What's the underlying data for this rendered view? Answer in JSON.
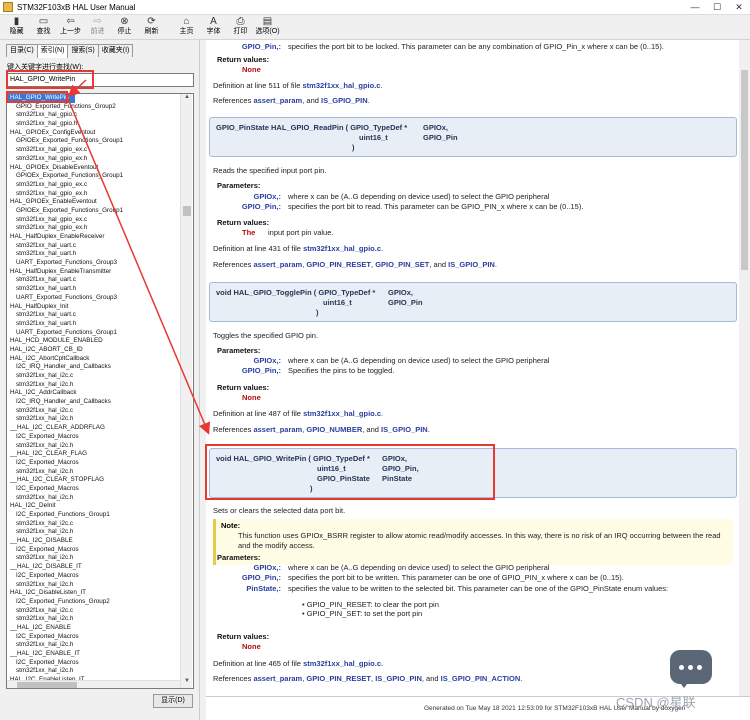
{
  "window": {
    "title": "STM32F103xB HAL User Manual"
  },
  "toolbar": [
    {
      "label": "隐藏",
      "icon": "▮"
    },
    {
      "label": "查找",
      "icon": "▭"
    },
    {
      "label": "上一步",
      "icon": "⇦"
    },
    {
      "label": "前进",
      "icon": "⇨",
      "disabled": true
    },
    {
      "label": "停止",
      "icon": "⊗"
    },
    {
      "label": "刷新",
      "icon": "⟳"
    },
    {
      "label": "主页",
      "icon": "⌂"
    },
    {
      "label": "字体",
      "icon": "A"
    },
    {
      "label": "打印",
      "icon": "⎙"
    },
    {
      "label": "选项(O)",
      "icon": "▤"
    }
  ],
  "left": {
    "tabs": [
      "目录(C)",
      "索引(N)",
      "搜索(S)",
      "收藏夹(I)"
    ],
    "keyword_label": "键入关键字进行查找(W):",
    "search_value": "HAL_GPIO_WritePin",
    "show_button": "显示(D)",
    "items": [
      {
        "t": "HAL_GPIO_WritePin",
        "lv": 1,
        "sel": true
      },
      {
        "t": "GPIO_Exported_Functions_Group2",
        "lv": 2
      },
      {
        "t": "stm32f1xx_hal_gpio.c",
        "lv": 2
      },
      {
        "t": "stm32f1xx_hal_gpio.h",
        "lv": 2
      },
      {
        "t": "HAL_GPIOEx_ConfigEventout",
        "lv": 1
      },
      {
        "t": "GPIOEx_Exported_Functions_Group1",
        "lv": 2
      },
      {
        "t": "stm32f1xx_hal_gpio_ex.c",
        "lv": 2
      },
      {
        "t": "stm32f1xx_hal_gpio_ex.h",
        "lv": 2
      },
      {
        "t": "HAL_GPIOEx_DisableEventout",
        "lv": 1
      },
      {
        "t": "GPIOEx_Exported_Functions_Group1",
        "lv": 2
      },
      {
        "t": "stm32f1xx_hal_gpio_ex.c",
        "lv": 2
      },
      {
        "t": "stm32f1xx_hal_gpio_ex.h",
        "lv": 2
      },
      {
        "t": "HAL_GPIOEx_EnableEventout",
        "lv": 1
      },
      {
        "t": "GPIOEx_Exported_Functions_Group1",
        "lv": 2
      },
      {
        "t": "stm32f1xx_hal_gpio_ex.c",
        "lv": 2
      },
      {
        "t": "stm32f1xx_hal_gpio_ex.h",
        "lv": 2
      },
      {
        "t": "HAL_HalfDuplex_EnableReceiver",
        "lv": 1
      },
      {
        "t": "stm32f1xx_hal_uart.c",
        "lv": 2
      },
      {
        "t": "stm32f1xx_hal_uart.h",
        "lv": 2
      },
      {
        "t": "UART_Exported_Functions_Group3",
        "lv": 2
      },
      {
        "t": "HAL_HalfDuplex_EnableTransmitter",
        "lv": 1
      },
      {
        "t": "stm32f1xx_hal_uart.c",
        "lv": 2
      },
      {
        "t": "stm32f1xx_hal_uart.h",
        "lv": 2
      },
      {
        "t": "UART_Exported_Functions_Group3",
        "lv": 2
      },
      {
        "t": "HAL_HalfDuplex_Init",
        "lv": 1
      },
      {
        "t": "stm32f1xx_hal_uart.c",
        "lv": 2
      },
      {
        "t": "stm32f1xx_hal_uart.h",
        "lv": 2
      },
      {
        "t": "UART_Exported_Functions_Group1",
        "lv": 2
      },
      {
        "t": "HAL_HCD_MODULE_ENABLED",
        "lv": 1
      },
      {
        "t": "HAL_I2C_ABORT_CB_ID",
        "lv": 1
      },
      {
        "t": "HAL_I2C_AbortCpltCallback",
        "lv": 1
      },
      {
        "t": "I2C_IRQ_Handler_and_Callbacks",
        "lv": 2
      },
      {
        "t": "stm32f1xx_hal_i2c.c",
        "lv": 2
      },
      {
        "t": "stm32f1xx_hal_i2c.h",
        "lv": 2
      },
      {
        "t": "HAL_I2C_AddrCallback",
        "lv": 1
      },
      {
        "t": "I2C_IRQ_Handler_and_Callbacks",
        "lv": 2
      },
      {
        "t": "stm32f1xx_hal_i2c.c",
        "lv": 2
      },
      {
        "t": "stm32f1xx_hal_i2c.h",
        "lv": 2
      },
      {
        "t": "__HAL_I2C_CLEAR_ADDRFLAG",
        "lv": 1
      },
      {
        "t": "I2C_Exported_Macros",
        "lv": 2
      },
      {
        "t": "stm32f1xx_hal_i2c.h",
        "lv": 2
      },
      {
        "t": "__HAL_I2C_CLEAR_FLAG",
        "lv": 1
      },
      {
        "t": "I2C_Exported_Macros",
        "lv": 2
      },
      {
        "t": "stm32f1xx_hal_i2c.h",
        "lv": 2
      },
      {
        "t": "__HAL_I2C_CLEAR_STOPFLAG",
        "lv": 1
      },
      {
        "t": "I2C_Exported_Macros",
        "lv": 2
      },
      {
        "t": "stm32f1xx_hal_i2c.h",
        "lv": 2
      },
      {
        "t": "HAL_I2C_DeInit",
        "lv": 1
      },
      {
        "t": "I2C_Exported_Functions_Group1",
        "lv": 2
      },
      {
        "t": "stm32f1xx_hal_i2c.c",
        "lv": 2
      },
      {
        "t": "stm32f1xx_hal_i2c.h",
        "lv": 2
      },
      {
        "t": "__HAL_I2C_DISABLE",
        "lv": 1
      },
      {
        "t": "I2C_Exported_Macros",
        "lv": 2
      },
      {
        "t": "stm32f1xx_hal_i2c.h",
        "lv": 2
      },
      {
        "t": "__HAL_I2C_DISABLE_IT",
        "lv": 1
      },
      {
        "t": "I2C_Exported_Macros",
        "lv": 2
      },
      {
        "t": "stm32f1xx_hal_i2c.h",
        "lv": 2
      },
      {
        "t": "HAL_I2C_DisableListen_IT",
        "lv": 1
      },
      {
        "t": "I2C_Exported_Functions_Group2",
        "lv": 2
      },
      {
        "t": "stm32f1xx_hal_i2c.c",
        "lv": 2
      },
      {
        "t": "stm32f1xx_hal_i2c.h",
        "lv": 2
      },
      {
        "t": "__HAL_I2C_ENABLE",
        "lv": 1
      },
      {
        "t": "I2C_Exported_Macros",
        "lv": 2
      },
      {
        "t": "stm32f1xx_hal_i2c.h",
        "lv": 2
      },
      {
        "t": "__HAL_I2C_ENABLE_IT",
        "lv": 1
      },
      {
        "t": "I2C_Exported_Macros",
        "lv": 2
      },
      {
        "t": "stm32f1xx_hal_i2c.h",
        "lv": 2
      },
      {
        "t": "HAL_I2C_EnableListen_IT",
        "lv": 1
      },
      {
        "t": "I2C_Exported_Functions_Group2",
        "lv": 2
      }
    ]
  },
  "content": {
    "lock_tail": {
      "pname": "GPIO_Pin,:",
      "pdesc": "specifies the port bit to be locked. This parameter can be any combination of GPIO_Pin_x where x can be (0..15).",
      "ret_hdr": "Return values:",
      "ret": "None",
      "def_pre": "Definition at line ",
      "def_line": "511",
      "def_mid": " of file ",
      "def_file": "stm32f1xx_hal_gpio.c",
      "def_end": ".",
      "ref_pre": "References ",
      "refs": "assert_param",
      "ref_and": ", and ",
      "ref_last": "IS_GPIO_PIN",
      "ref_end": "."
    },
    "read": {
      "sig1": "GPIO_PinState HAL_GPIO_ReadPin ( GPIO_TypeDef *",
      "sig1p": "GPIOx,",
      "sig2": "uint16_t",
      "sig2p": "GPIO_Pin",
      "sig3": ")",
      "desc": "Reads the specified input port pin.",
      "params_hdr": "Parameters:",
      "p1": "GPIOx,:",
      "p1d": "where x can be (A..G depending on device used) to select the GPIO peripheral",
      "p2": "GPIO_Pin,:",
      "p2d": "specifies the port bit to read. This parameter can be GPIO_PIN_x where x can be (0..15).",
      "ret_hdr": "Return values:",
      "ret": "The",
      "retd": "input port pin value.",
      "def_pre": "Definition at line ",
      "def_line": "431",
      "def_mid": " of file ",
      "def_file": "stm32f1xx_hal_gpio.c",
      "def_end": ".",
      "ref_pre": "References ",
      "r1": "assert_param",
      "r2": "GPIO_PIN_RESET",
      "r3": "GPIO_PIN_SET",
      "ref_and": ", and ",
      "r4": "IS_GPIO_PIN",
      "sep": ", ",
      "ref_end": "."
    },
    "toggle": {
      "sig1": "void HAL_GPIO_TogglePin ( GPIO_TypeDef *",
      "sig1p": "GPIOx,",
      "sig2": "uint16_t",
      "sig2p": "GPIO_Pin",
      "sig3": ")",
      "desc": "Toggles the specified GPIO pin.",
      "params_hdr": "Parameters:",
      "p1": "GPIOx,:",
      "p1d": "where x can be (A..G depending on device used) to select the GPIO peripheral",
      "p2": "GPIO_Pin,:",
      "p2d": "Specifies the pins to be toggled.",
      "ret_hdr": "Return values:",
      "ret": "None",
      "def_pre": "Definition at line ",
      "def_line": "487",
      "def_mid": " of file ",
      "def_file": "stm32f1xx_hal_gpio.c",
      "def_end": ".",
      "ref_pre": "References ",
      "r1": "assert_param",
      "r2": "GPIO_NUMBER",
      "ref_and": ", and ",
      "r3": "IS_GPIO_PIN",
      "sep": ", ",
      "ref_end": "."
    },
    "write": {
      "sig1": "void HAL_GPIO_WritePin ( GPIO_TypeDef *",
      "sig1p": "GPIOx,",
      "sig2": "uint16_t",
      "sig2p": "GPIO_Pin,",
      "sig3": "GPIO_PinState",
      "sig3p": "PinState",
      "sig4": ")",
      "desc": "Sets or clears the selected data port bit.",
      "note_hdr": "Note:",
      "note": "This function uses GPIOx_BSRR register to allow atomic read/modify accesses. In this way, there is no risk of an IRQ occurring between the read and the modify access.",
      "params_hdr": "Parameters:",
      "p1": "GPIOx,:",
      "p1d": "where x can be (A..G depending on device used) to select the GPIO peripheral",
      "p2": "GPIO_Pin,:",
      "p2d": "specifies the port bit to be written. This parameter can be one of GPIO_PIN_x where x can be (0..15).",
      "p3": "PinState,:",
      "p3d": "specifies the value to be written to the selected bit. This parameter can be one of the GPIO_PinState enum values:",
      "b1": "GPIO_PIN_RESET: to clear the port pin",
      "b2": "GPIO_PIN_SET: to set the port pin",
      "ret_hdr": "Return values:",
      "ret": "None",
      "def_pre": "Definition at line ",
      "def_line": "465",
      "def_mid": " of file ",
      "def_file": "stm32f1xx_hal_gpio.c",
      "def_end": ".",
      "ref_pre": "References ",
      "r1": "assert_param",
      "r2": "GPIO_PIN_RESET",
      "r3": "IS_GPIO_PIN",
      "ref_and": ", and ",
      "r4": "IS_GPIO_PIN_ACTION",
      "sep": ", ",
      "ref_end": "."
    }
  },
  "status": {
    "generated": "Generated on Tue May 18 2021 12:53:09 for STM32F103xB HAL User Manual by doxygen"
  },
  "watermark": "CSDN @星联"
}
